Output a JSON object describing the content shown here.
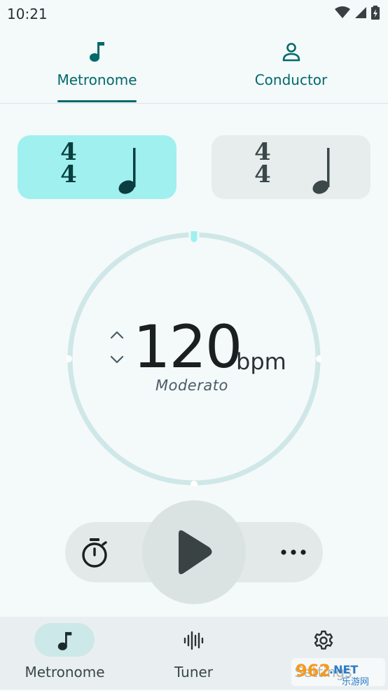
{
  "status_bar": {
    "time": "10:21"
  },
  "top_tabs": [
    {
      "label": "Metronome",
      "icon": "music-note-icon",
      "selected": true
    },
    {
      "label": "Conductor",
      "icon": "person-icon",
      "selected": false
    }
  ],
  "beat_cards": [
    {
      "numerator": "4",
      "denominator": "4",
      "note": "quarter-note-icon",
      "active": true
    },
    {
      "numerator": "4",
      "denominator": "4",
      "note": "quarter-note-icon",
      "active": false
    }
  ],
  "tempo": {
    "bpm": "120",
    "unit": "bpm",
    "name": "Moderato"
  },
  "bottom_nav": [
    {
      "label": "Metronome",
      "icon": "music-note-icon",
      "selected": true
    },
    {
      "label": "Tuner",
      "icon": "waveform-icon",
      "selected": false
    },
    {
      "label": "Settings",
      "icon": "gear-icon",
      "selected": false
    }
  ],
  "watermark": {
    "number": "962",
    "suffix": ".NET",
    "site": "乐游网"
  },
  "colors": {
    "accent": "#00696b",
    "active_card": "#9ff0ee",
    "inactive_card": "#e7ecec",
    "dial_ring": "#cfe7e7",
    "background": "#f4f9fa"
  }
}
